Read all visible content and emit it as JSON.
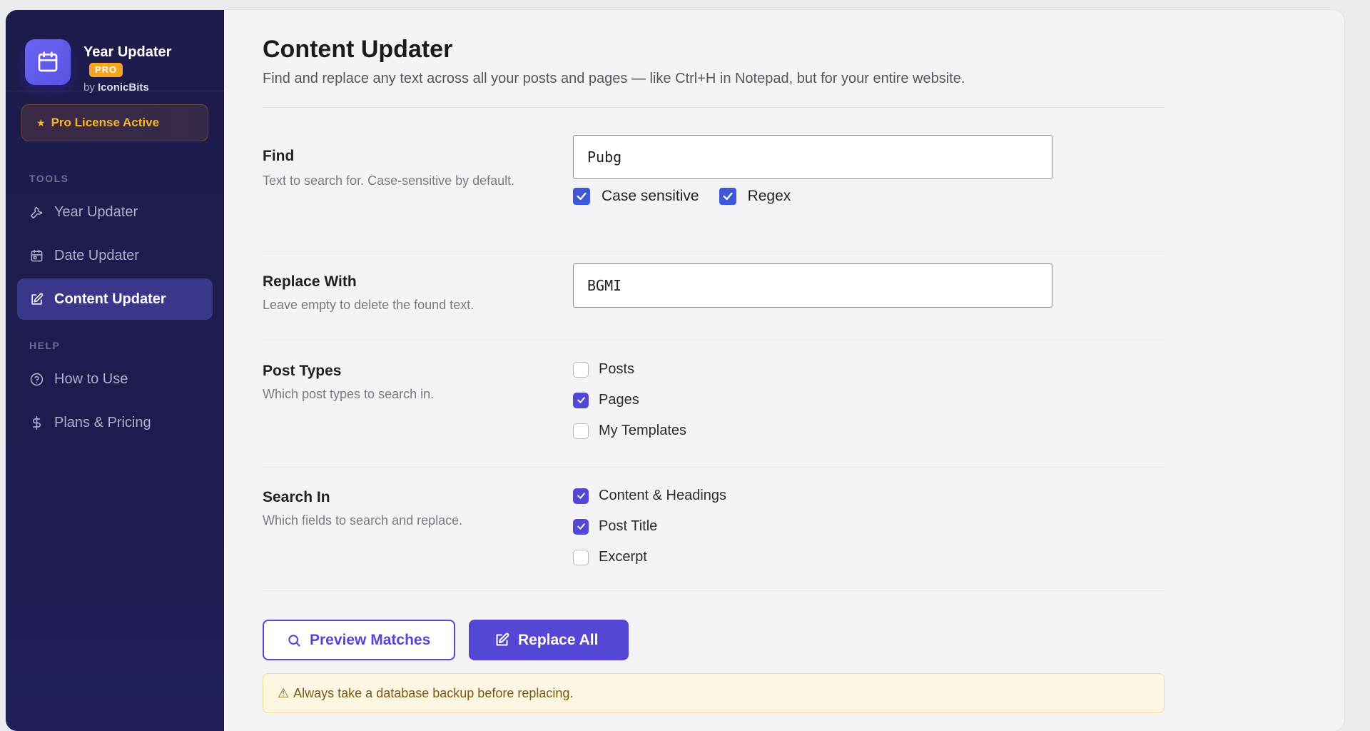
{
  "brand": {
    "title": "Year Updater",
    "badge": "PRO",
    "by_prefix": "by",
    "by_name": "IconicBits"
  },
  "license": {
    "label": "Pro License Active"
  },
  "sidebar": {
    "tools_label": "TOOLS",
    "help_label": "HELP",
    "tools": [
      {
        "label": "Year Updater",
        "icon": "wrench-icon"
      },
      {
        "label": "Date Updater",
        "icon": "calendar-icon"
      },
      {
        "label": "Content Updater",
        "icon": "edit-icon",
        "active": true
      }
    ],
    "help": [
      {
        "label": "How to Use",
        "icon": "help-circle-icon"
      },
      {
        "label": "Plans & Pricing",
        "icon": "dollar-icon"
      }
    ]
  },
  "page": {
    "title": "Content Updater",
    "subtitle": "Find and replace any text across all your posts and pages — like Ctrl+H in Notepad, but for your entire website."
  },
  "find": {
    "title": "Find",
    "desc": "Text to search for. Case-sensitive by default.",
    "value": "Pubg",
    "case_sensitive_label": "Case sensitive",
    "case_sensitive": true,
    "regex_label": "Regex",
    "regex": true
  },
  "replace": {
    "title": "Replace With",
    "desc": "Leave empty to delete the found text.",
    "value": "BGMI"
  },
  "post_types": {
    "title": "Post Types",
    "desc": "Which post types to search in.",
    "options": [
      {
        "label": "Posts",
        "checked": false
      },
      {
        "label": "Pages",
        "checked": true
      },
      {
        "label": "My Templates",
        "checked": false
      }
    ]
  },
  "search_in": {
    "title": "Search In",
    "desc": "Which fields to search and replace.",
    "options": [
      {
        "label": "Content & Headings",
        "checked": true
      },
      {
        "label": "Post Title",
        "checked": true
      },
      {
        "label": "Excerpt",
        "checked": false
      }
    ]
  },
  "actions": {
    "preview_label": "Preview Matches",
    "replace_label": "Replace All"
  },
  "warning": {
    "icon": "⚠",
    "text": "Always take a database backup before replacing."
  },
  "colors": {
    "accent": "#5547d6",
    "sidebar_bg": "#1d1b4a",
    "badge": "#f5a524",
    "license_text": "#f5b62e",
    "warning_bg": "#fdf6e2"
  }
}
